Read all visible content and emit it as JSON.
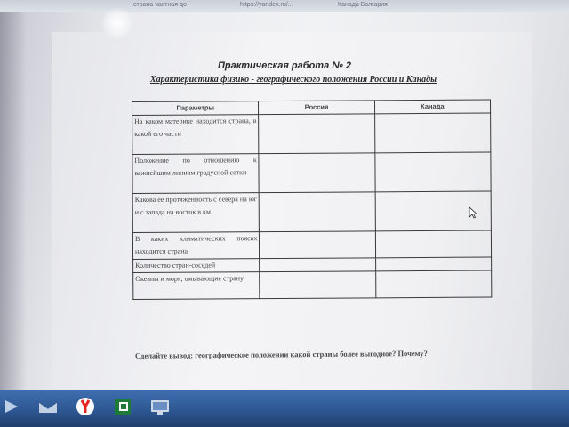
{
  "browser_tabs": [
    {
      "label": "страна частная до"
    },
    {
      "label": "https://yandex.ru/..."
    },
    {
      "label": "Канада Болгария"
    }
  ],
  "document": {
    "title": "Практическая работа № 2",
    "subtitle": "Характеристика физико - географического положения России и Канады",
    "table": {
      "headers": [
        "Параметры",
        "Россия",
        "Канада"
      ],
      "rows": [
        {
          "param": "На каком материке находится страна, в какой его части",
          "russia": "",
          "canada": ""
        },
        {
          "param": "Положение по отношению к важнейшим линиям градусной сетки",
          "russia": "",
          "canada": ""
        },
        {
          "param": "Какова ее протяженность с севера на юг и с запада на восток в км",
          "russia": "",
          "canada": ""
        },
        {
          "param": "В каких климатических поясах находится страна",
          "russia": "",
          "canada": ""
        },
        {
          "param": "Количество стран-соседей",
          "russia": "",
          "canada": ""
        },
        {
          "param": "Океаны и моря, омывающие страну",
          "russia": "",
          "canada": ""
        }
      ]
    },
    "conclusion": "Сделайте вывод: географическое положении какой страны более выгодное? Почему?"
  },
  "taskbar": {
    "items": [
      "start-icon",
      "mail-icon",
      "yandex-browser-icon",
      "excel-icon",
      "monitor-icon"
    ],
    "colors": {
      "yandex": "#e52620",
      "excel": "#1f7a3a",
      "taskbar": "#2c5590"
    }
  }
}
